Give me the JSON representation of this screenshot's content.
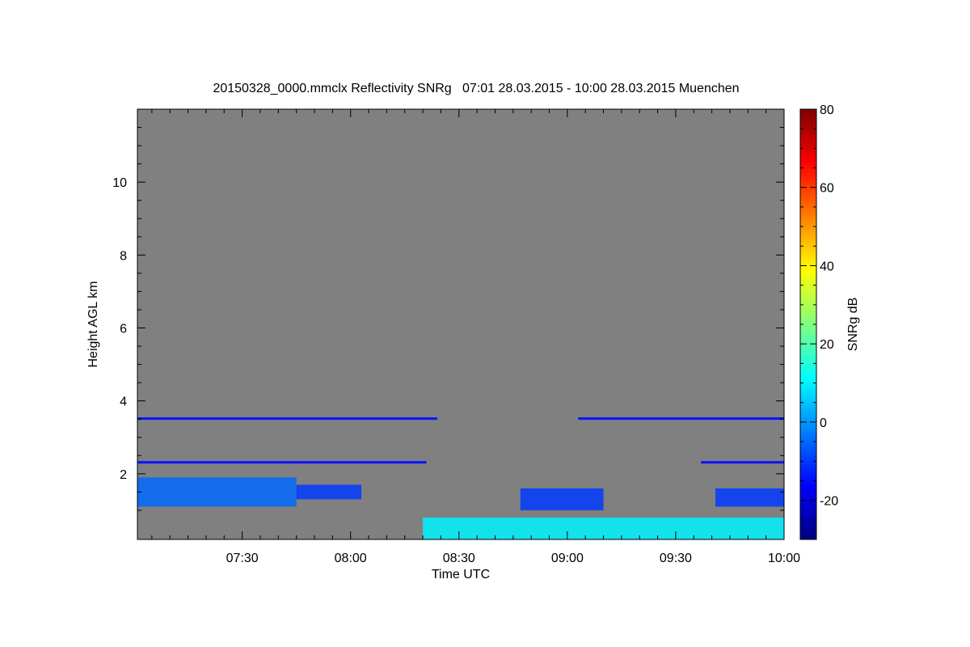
{
  "chart_data": {
    "type": "heatmap",
    "title": "20150328_0000.mmclx Reflectivity SNRg   07:01 28.03.2015 - 10:00 28.03.2015 Muenchen",
    "xlabel": "Time UTC",
    "ylabel": "Height AGL km",
    "xlim": [
      "07:01",
      "10:00"
    ],
    "ylim": [
      0.2,
      12.0
    ],
    "x_ticks": [
      "07:30",
      "08:00",
      "08:30",
      "09:00",
      "09:30",
      "10:00"
    ],
    "y_ticks": [
      2,
      4,
      6,
      8,
      10
    ],
    "background_color": "#808080",
    "colorbar": {
      "label": "SNRg dB",
      "range": [
        -30,
        80
      ],
      "ticks": [
        -20,
        0,
        20,
        40,
        60,
        80
      ],
      "colormap": "jet",
      "colors": [
        "#00007f",
        "#0000ff",
        "#007fff",
        "#00ffff",
        "#7fff7f",
        "#ffff00",
        "#ff7f00",
        "#ff0000",
        "#7f0000"
      ]
    },
    "features": [
      {
        "name": "low cloud layer",
        "start": "07:01",
        "end": "07:45",
        "base_km": 1.1,
        "top_km": 1.9,
        "snr_db": -5
      },
      {
        "name": "low cloud layer",
        "start": "07:45",
        "end": "08:03",
        "base_km": 1.3,
        "top_km": 1.7,
        "snr_db": -10
      },
      {
        "name": "low cloud layer",
        "start": "08:47",
        "end": "09:10",
        "base_km": 1.0,
        "top_km": 1.6,
        "snr_db": -10
      },
      {
        "name": "low cloud layer",
        "start": "09:41",
        "end": "10:00",
        "base_km": 1.1,
        "top_km": 1.6,
        "snr_db": -10
      },
      {
        "name": "boundary layer echo",
        "start": "08:20",
        "end": "10:00",
        "base_km": 0.2,
        "top_km": 0.8,
        "snr_db": 10
      },
      {
        "name": "horizontal line",
        "start": "07:01",
        "end": "08:24",
        "base_km": 3.48,
        "top_km": 3.55,
        "snr_db": -15
      },
      {
        "name": "horizontal line",
        "start": "09:03",
        "end": "10:00",
        "base_km": 3.48,
        "top_km": 3.55,
        "snr_db": -15
      },
      {
        "name": "horizontal line",
        "start": "07:01",
        "end": "08:21",
        "base_km": 2.28,
        "top_km": 2.35,
        "snr_db": -15
      },
      {
        "name": "horizontal line",
        "start": "09:37",
        "end": "10:00",
        "base_km": 2.28,
        "top_km": 2.35,
        "snr_db": -15
      }
    ]
  }
}
